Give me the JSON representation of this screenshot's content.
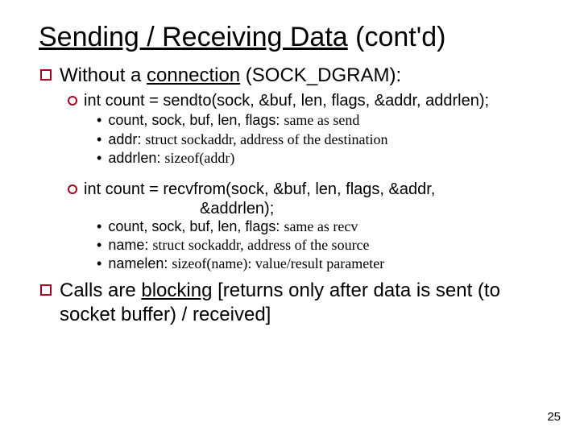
{
  "title": {
    "main": "Sending / Receiving Data",
    "suffix": " (cont'd)"
  },
  "b1": {
    "prefix": "Without a ",
    "underline": "connection",
    "suffix": " (SOCK_DGRAM):",
    "sendto": {
      "sig": "int count = sendto(sock, &buf, len, flags, &addr, addrlen);",
      "n1a": "count, sock, buf, len, flags: ",
      "n1b": "same as send",
      "n2a": "addr: ",
      "n2b": "struct sockaddr, address of the destination",
      "n3a": "addrlen: ",
      "n3b": "sizeof(addr)"
    },
    "recvfrom": {
      "sig1": "int count = recvfrom(sock, &buf,  len, flags, &addr,",
      "sig2": "&addrlen);",
      "n1a": "count, sock, buf, len, flags: ",
      "n1b": "same as recv",
      "n2a": "name: ",
      "n2b": "struct sockaddr, address of the source",
      "n3a": "namelen: ",
      "n3b": "sizeof(name): value/result parameter"
    }
  },
  "b2": {
    "pre": "Calls are ",
    "blocking": "blocking",
    "post": " [returns only after data is sent (to socket buffer) / received]"
  },
  "page": "25"
}
